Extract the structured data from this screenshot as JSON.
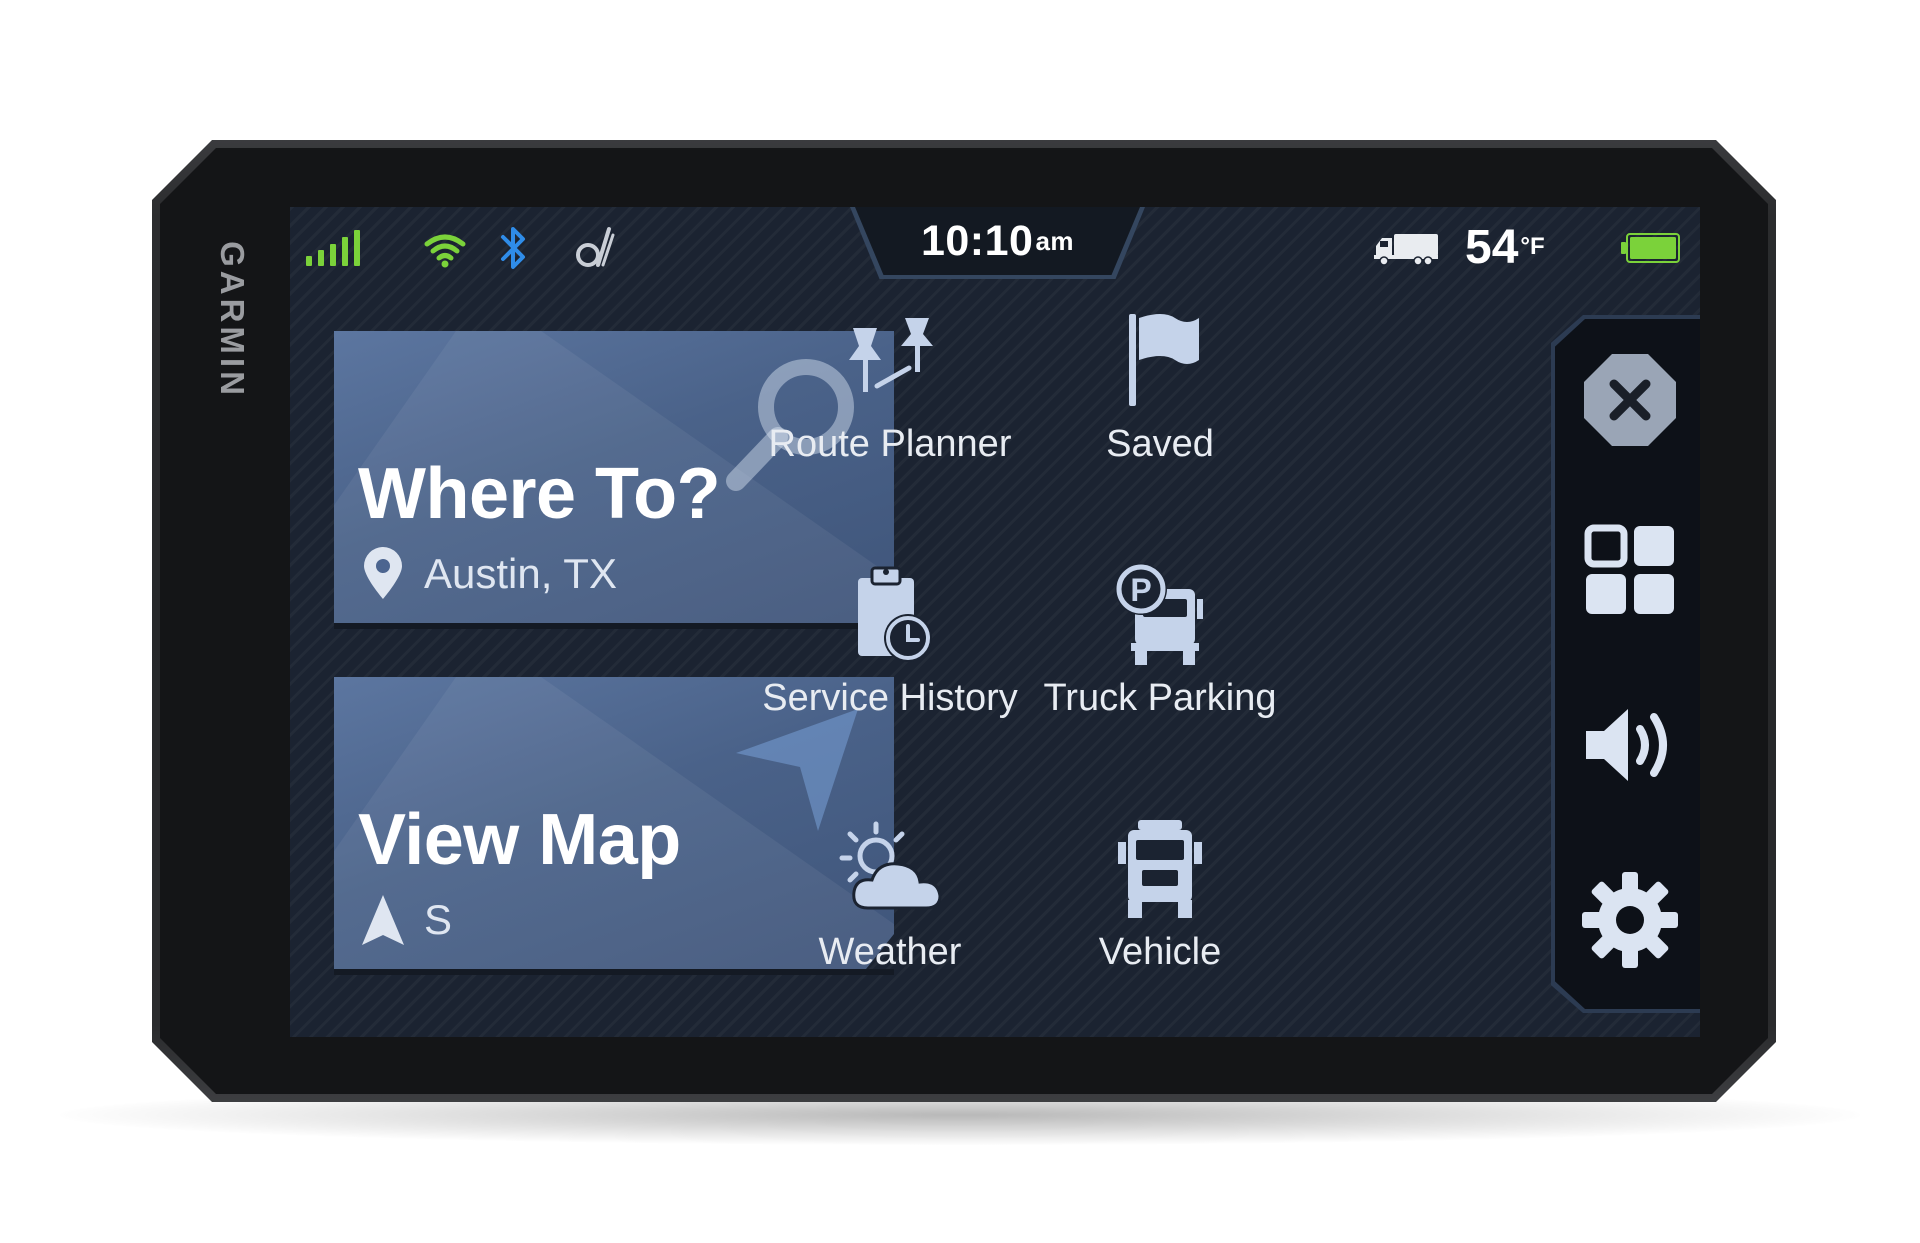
{
  "device": {
    "brand": "GARMIN"
  },
  "status_bar": {
    "icons": [
      "signal-bars-icon",
      "wifi-icon",
      "bluetooth-icon",
      "drive-link-icon",
      "truck-icon",
      "battery-icon"
    ],
    "time": "10:10",
    "time_suffix": "am",
    "temperature": "54",
    "temperature_unit": "°F",
    "battery_color": "#7bd23a",
    "accent_green": "#7bd23a",
    "accent_blue": "#2f8ce8"
  },
  "cards": {
    "where_to": {
      "title": "Where To?",
      "location": "Austin, TX",
      "icon": "search-icon"
    },
    "view_map": {
      "title": "View Map",
      "heading": "S",
      "icon": "navigation-arrow-icon"
    }
  },
  "menu": {
    "route_planner": {
      "label": "Route Planner",
      "icon": "route-planner-icon"
    },
    "saved": {
      "label": "Saved",
      "icon": "flag-icon"
    },
    "service_history": {
      "label": "Service History",
      "icon": "service-history-icon"
    },
    "truck_parking": {
      "label": "Truck Parking",
      "icon": "truck-parking-icon"
    },
    "weather": {
      "label": "Weather",
      "icon": "weather-icon"
    },
    "vehicle": {
      "label": "Vehicle",
      "icon": "vehicle-icon"
    }
  },
  "rail": {
    "buttons": [
      "close-icon",
      "apps-grid-icon",
      "volume-icon",
      "settings-icon"
    ]
  }
}
